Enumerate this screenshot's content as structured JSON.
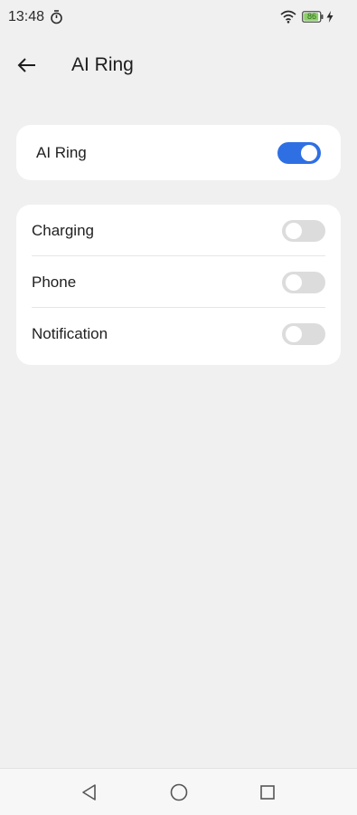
{
  "status_bar": {
    "time": "13:48",
    "battery_level": "86",
    "icons": [
      "timer-icon",
      "wifi-icon",
      "battery-icon",
      "charging-bolt-icon"
    ],
    "battery_color": "#8ccf6a"
  },
  "header": {
    "title": "AI Ring",
    "back_icon": "arrow-left-icon"
  },
  "main_card": {
    "label": "AI Ring",
    "enabled": true
  },
  "options": [
    {
      "label": "Charging",
      "enabled": false
    },
    {
      "label": "Phone",
      "enabled": false
    },
    {
      "label": "Notification",
      "enabled": false
    }
  ],
  "nav_bar": {
    "icons": [
      "nav-back-triangle-icon",
      "nav-home-circle-icon",
      "nav-recents-square-icon"
    ]
  },
  "colors": {
    "accent": "#2f6fe4",
    "toggle_off": "#dcdcdc",
    "background": "#f0f0f0",
    "card": "#ffffff"
  }
}
